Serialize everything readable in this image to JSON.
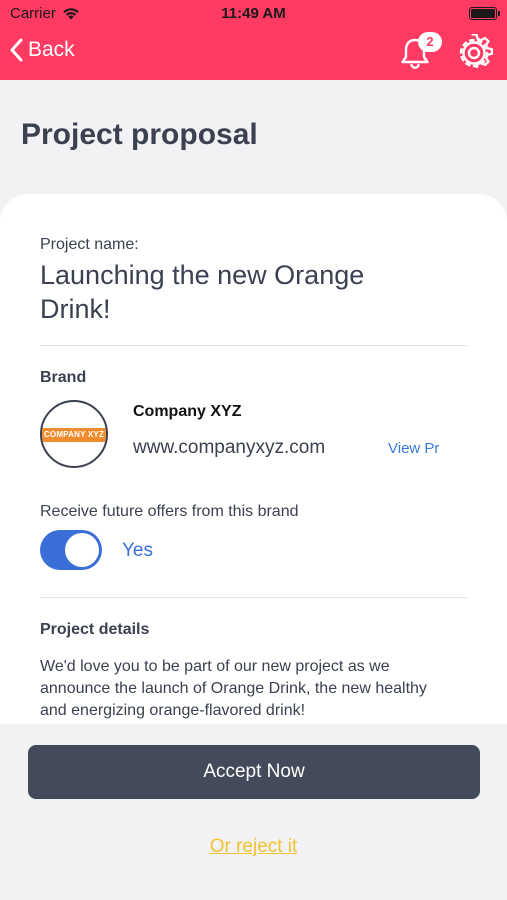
{
  "status_bar": {
    "carrier": "Carrier",
    "time": "11:49 AM"
  },
  "nav": {
    "back_label": "Back",
    "notification_count": "2",
    "bar_color": "#ff3b63"
  },
  "page_title": "Project proposal",
  "project": {
    "name_label": "Project name:",
    "name": "Launching the new Orange Drink!"
  },
  "brand": {
    "section_title": "Brand",
    "logo_text": "COMPANY XYZ",
    "company_name": "Company XYZ",
    "website": "www.companyxyz.com",
    "view_profile_label": "View Pr"
  },
  "offers": {
    "label": "Receive future offers from this brand",
    "toggle_value": "Yes",
    "toggle_on": true
  },
  "details": {
    "section_title": "Project details",
    "text": "We'd love you to be part of our new project as we announce the launch of Orange Drink, the new healthy and energizing orange-flavored drink!"
  },
  "actions": {
    "accept_label": "Accept Now",
    "reject_label": "Or reject it"
  }
}
